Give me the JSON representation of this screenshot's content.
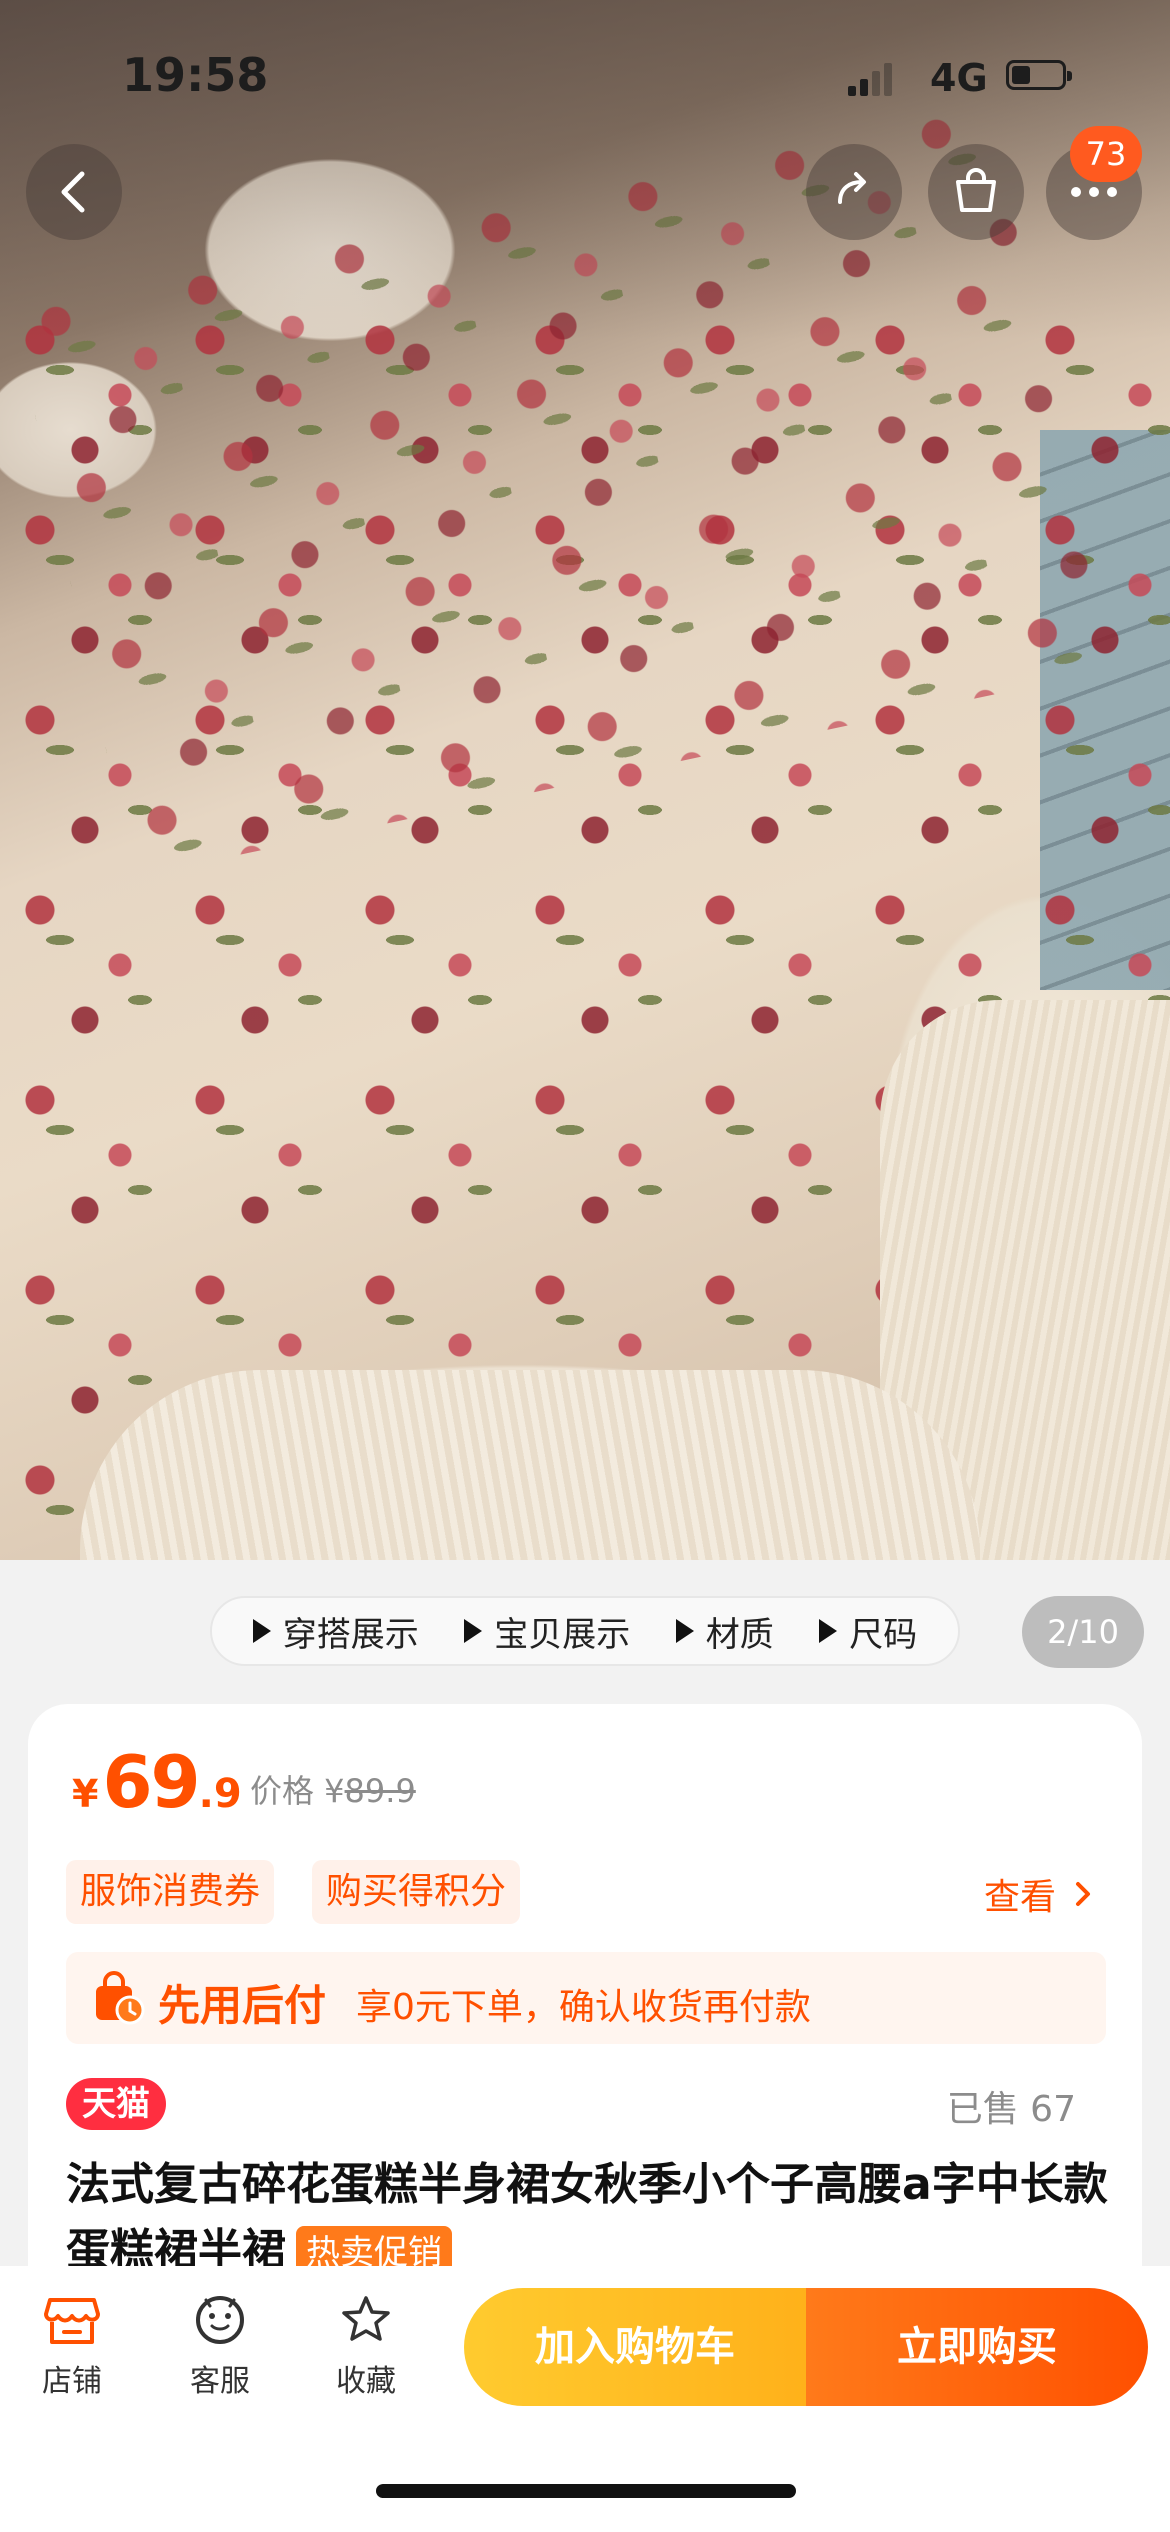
{
  "status_bar": {
    "time": "19:58",
    "network": "4G"
  },
  "header": {
    "cart_badge": "73"
  },
  "gallery": {
    "tabs": [
      "穿搭展示",
      "宝贝展示",
      "材质",
      "尺码"
    ],
    "counter": "2/10"
  },
  "price": {
    "currency": "¥",
    "integer": "69",
    "decimal": ".9",
    "original_label": "价格 ¥",
    "original_value": "89.9"
  },
  "promos": {
    "chip1": "服饰消费券",
    "chip2": "购买得积分",
    "view": "查看"
  },
  "pay_later": {
    "title": "先用后付",
    "desc": "享0元下单，确认收货再付款"
  },
  "product": {
    "store_badge": "天猫",
    "sold": "已售 67",
    "title": "法式复古碎花蛋糕半身裙女秋季小个子高腰a字中长款蛋糕裙半裙",
    "tag": "热卖促销"
  },
  "bottom_bar": {
    "shop": "店铺",
    "service": "客服",
    "favorite": "收藏",
    "add_to_cart": "加入购物车",
    "buy_now": "立即购买"
  },
  "colors": {
    "accent": "#ff5000",
    "tmall": "#ff2e40",
    "cart_button": "#ffb11a"
  }
}
